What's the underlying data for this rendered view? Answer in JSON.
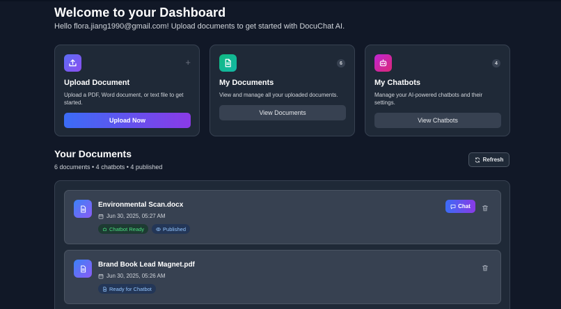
{
  "header": {
    "title": "Welcome to your Dashboard",
    "subtitle": "Hello flora.jiang1990@gmail.com! Upload documents to get started with DocuChat AI."
  },
  "cards": {
    "upload": {
      "title": "Upload Document",
      "description": "Upload a PDF, Word document, or text file to get started.",
      "button": "Upload Now",
      "corner": "+",
      "icon": "upload-icon",
      "color": "#6d5df5"
    },
    "documents": {
      "title": "My Documents",
      "description": "View and manage all your uploaded documents.",
      "button": "View Documents",
      "count": "6",
      "icon": "document-icon",
      "color": "#14b8a6"
    },
    "chatbots": {
      "title": "My Chatbots",
      "description": "Manage your AI-powered chatbots and their settings.",
      "button": "View Chatbots",
      "count": "4",
      "icon": "bot-icon",
      "color": "#c026d3"
    }
  },
  "documents_section": {
    "title": "Your Documents",
    "meta": "6 documents • 4 chatbots • 4 published",
    "refresh_label": "Refresh",
    "items": [
      {
        "name": "Environmental Scan.docx",
        "date": "Jun 30, 2025, 05:27 AM",
        "tags": [
          "Chatbot Ready",
          "Published"
        ],
        "chat_label": "Chat"
      },
      {
        "name": "Brand Book Lead Magnet.pdf",
        "date": "Jun 30, 2025, 05:26 AM",
        "tags": [
          "Ready for Chatbot"
        ]
      }
    ]
  },
  "colors": {
    "background": "#111827",
    "card": "#1f2937",
    "accent_start": "#3b6cf6",
    "accent_end": "#8a3ae6",
    "success": "#4ade80",
    "info": "#93c5fd"
  }
}
